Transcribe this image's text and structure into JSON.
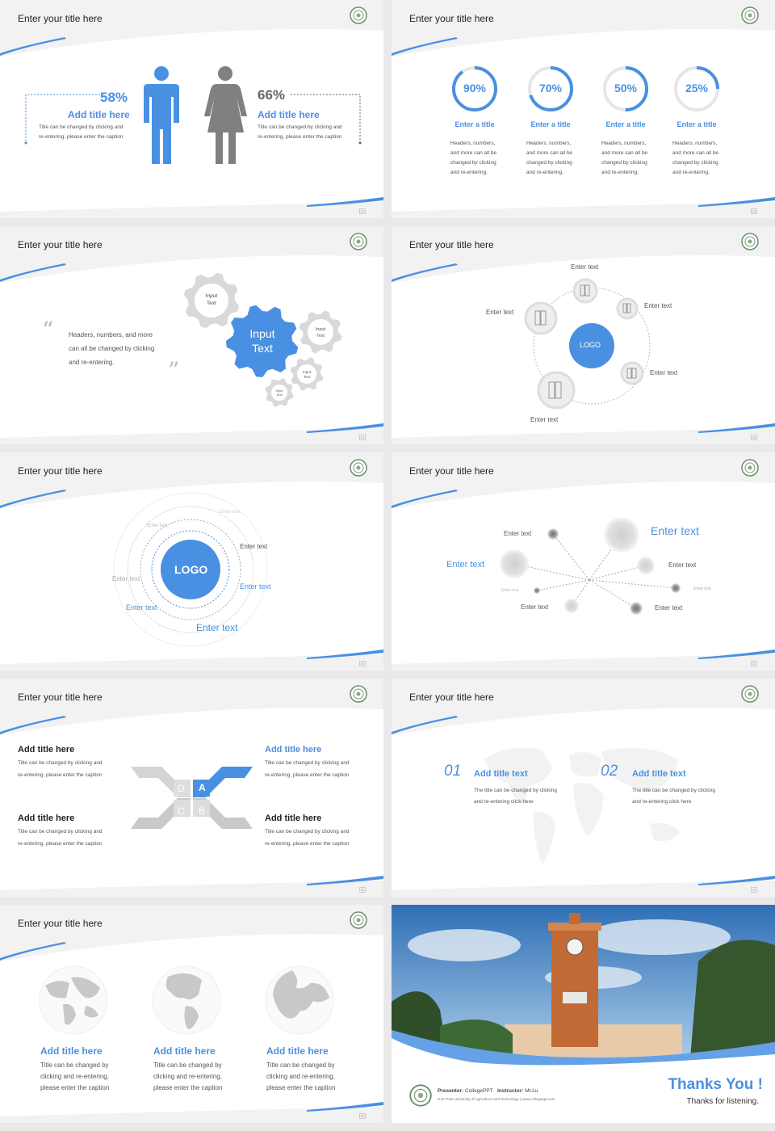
{
  "slide_title": "Enter your title here",
  "colors": {
    "accent": "#4a90e2",
    "gray": "#8a8a8a",
    "light": "#d9d9d9"
  },
  "slides": {
    "s1": {
      "page": "22",
      "left": {
        "pct": "58%",
        "title": "Add title here",
        "text1": "Title can be changed by clicking and",
        "text2": "re-entering, please enter the caption"
      },
      "right": {
        "pct": "66%",
        "title": "Add title here",
        "text1": "Title can be changed by clicking and",
        "text2": "re-entering, please enter the caption"
      }
    },
    "s2": {
      "page": "23",
      "rings": [
        {
          "pct": "90%",
          "value": 0.9,
          "title": "Enter a title",
          "l1": "Headers, numbers,",
          "l2": "and more can all be",
          "l3": "changed by clicking",
          "l4": "and re-entering."
        },
        {
          "pct": "70%",
          "value": 0.7,
          "title": "Enter a title",
          "l1": "Headers, numbers,",
          "l2": "and more can all be",
          "l3": "changed by clicking",
          "l4": "and re-entering."
        },
        {
          "pct": "50%",
          "value": 0.5,
          "title": "Enter a title",
          "l1": "Headers, numbers,",
          "l2": "and more can all be",
          "l3": "changed by clicking",
          "l4": "and re-entering."
        },
        {
          "pct": "25%",
          "value": 0.25,
          "title": "Enter a title",
          "l1": "Headers, numbers,",
          "l2": "and more can all be",
          "l3": "changed by clicking",
          "l4": "and re-entering."
        }
      ]
    },
    "s3": {
      "page": "24",
      "quote_open": "“",
      "quote_close": "”",
      "q1": "Headers, numbers, and more",
      "q2": "can all be changed by clicking",
      "q3": "and re-entering.",
      "big_gear_1": "Input",
      "big_gear_2": "Text",
      "gear_a_1": "Input",
      "gear_a_2": "Text",
      "gear_b_1": "Input",
      "gear_b_2": "Text",
      "gear_c_1": "Input",
      "gear_c_2": "Text",
      "gear_d_1": "Input",
      "gear_d_2": "Text"
    },
    "s4": {
      "page": "25",
      "logo": "LOGO",
      "labels": [
        "Enter text",
        "Enter text",
        "Enter text",
        "Enter text",
        "Enter text"
      ]
    },
    "s5": {
      "page": "26",
      "logo": "LOGO",
      "labels": [
        "Enter text",
        "Enter text",
        "Enter text",
        "Enter text",
        "Enter text",
        "Enter text",
        "Enter text"
      ]
    },
    "s6": {
      "page": "27",
      "big": "Enter text",
      "left": "Enter text",
      "labels": [
        "Enter text",
        "Enter text",
        "Enter text",
        "Enter text",
        "Enter text",
        "Enter text"
      ],
      "tiny_left": "Enter text"
    },
    "s7": {
      "page": "28",
      "items": [
        {
          "title": "Add title here",
          "t1": "Title can be changed by clicking and",
          "t2": "re-entering, please enter the caption"
        },
        {
          "title": "Add title here",
          "t1": "Title can be changed by clicking and",
          "t2": "re-entering, please enter the caption"
        },
        {
          "title": "Add title here",
          "t1": "Title can be changed by clicking and",
          "t2": "re-entering, please enter the caption"
        },
        {
          "title": "Add title here",
          "t1": "Title can be changed by clicking and",
          "t2": "re-entering, please enter the caption"
        }
      ],
      "letters": {
        "a": "A",
        "b": "B",
        "c": "C",
        "d": "D"
      }
    },
    "s8": {
      "page": "29",
      "items": [
        {
          "num": "01",
          "title": "Add title text",
          "t1": "The title can be changed by clicking",
          "t2": "and re-entering click here"
        },
        {
          "num": "02",
          "title": "Add title text",
          "t1": "The title can be changed by clicking",
          "t2": "and re-entering click here"
        }
      ]
    },
    "s9": {
      "page": "30",
      "items": [
        {
          "title": "Add title here",
          "t1": "Title can be changed by",
          "t2": "clicking and re-entering,",
          "t3": "please enter the caption"
        },
        {
          "title": "Add title here",
          "t1": "Title can be changed by",
          "t2": "clicking and re-entering,",
          "t3": "please enter the caption"
        },
        {
          "title": "Add title here",
          "t1": "Title can be changed by",
          "t2": "clicking and re-entering,",
          "t3": "please enter the caption"
        }
      ]
    },
    "s10": {
      "presenter_label": "Presenter:",
      "presenter": "CollegePPT",
      "instructor_label": "Instructor:",
      "instructor": "Mr.Lu",
      "university": "G.B. Pant University of Agriculture and Technology  |  www.collegeppt.com",
      "thanks": "Thanks You !",
      "thanks_sub": "Thanks for listening."
    }
  }
}
